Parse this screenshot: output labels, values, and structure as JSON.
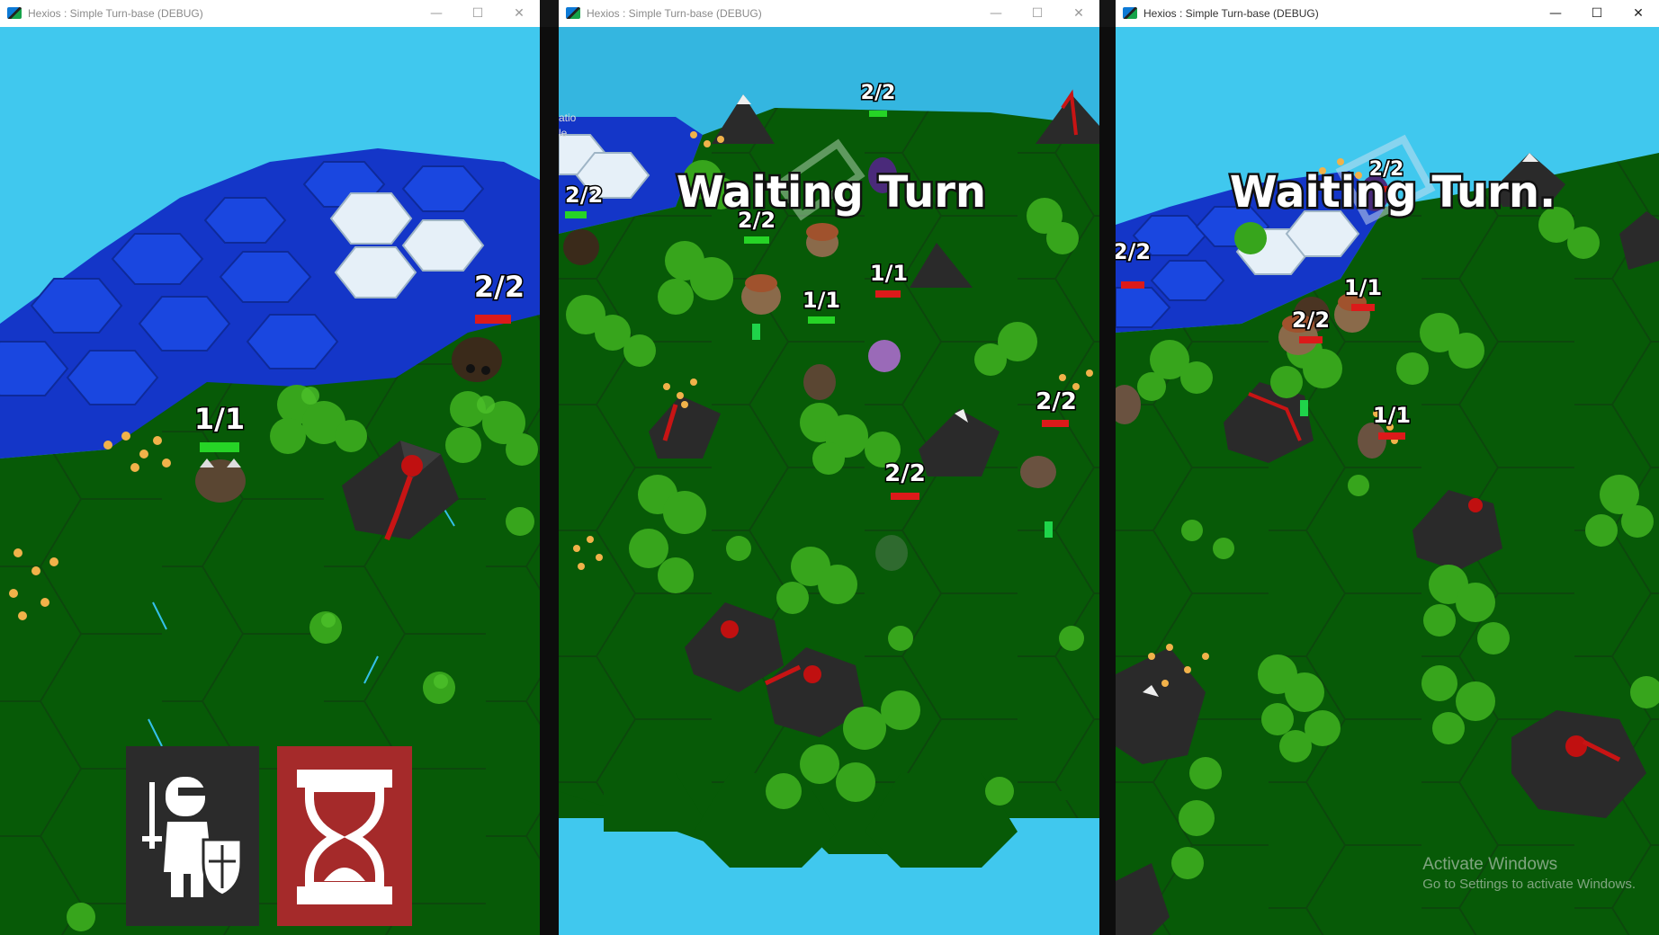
{
  "windows": [
    {
      "title": "Hexios : Simple Turn-base (DEBUG)",
      "active": false,
      "controls": {
        "minimize": "—",
        "maximize": "☐",
        "close": "✕"
      },
      "units": [
        {
          "hp": "2/2",
          "bar": "red"
        },
        {
          "hp": "1/1",
          "bar": "green"
        }
      ],
      "hud": {
        "unit_icon": "knight-shield-icon",
        "end_turn_icon": "hourglass-icon"
      }
    },
    {
      "title": "Hexios : Simple Turn-base (DEBUG)",
      "active": false,
      "controls": {
        "minimize": "—",
        "maximize": "☐",
        "close": "✕"
      },
      "status": "Waiting Turn",
      "side_text": [
        "atio",
        "le"
      ],
      "units": [
        {
          "hp": "2/2",
          "bar": "green"
        },
        {
          "hp": "2/2",
          "bar": "green"
        },
        {
          "hp": "2/2",
          "bar": "green"
        },
        {
          "hp": "1/1",
          "bar": "red"
        },
        {
          "hp": "1/1",
          "bar": "green"
        },
        {
          "hp": "2/2",
          "bar": "red"
        },
        {
          "hp": "2/2",
          "bar": "red"
        }
      ]
    },
    {
      "title": "Hexios : Simple Turn-base (DEBUG)",
      "active": true,
      "controls": {
        "minimize": "—",
        "maximize": "☐",
        "close": "✕"
      },
      "status": "Waiting Turn.",
      "units": [
        {
          "hp": "2/2",
          "bar": "red"
        },
        {
          "hp": "2/2",
          "bar": "red"
        },
        {
          "hp": "1/1",
          "bar": "red"
        },
        {
          "hp": "2/2",
          "bar": "red"
        },
        {
          "hp": "1/1",
          "bar": "red"
        }
      ],
      "watermark": {
        "line1": "Activate Windows",
        "line2": "Go to Settings to activate Windows."
      }
    }
  ],
  "colors": {
    "sky": "#40c8ee",
    "grass": "#075a07",
    "water": "#1436c8",
    "hp_red": "#dc1a1a",
    "hp_green": "#26d426",
    "hud_red": "#a52a2a",
    "hud_dark": "#2b2b2b"
  }
}
